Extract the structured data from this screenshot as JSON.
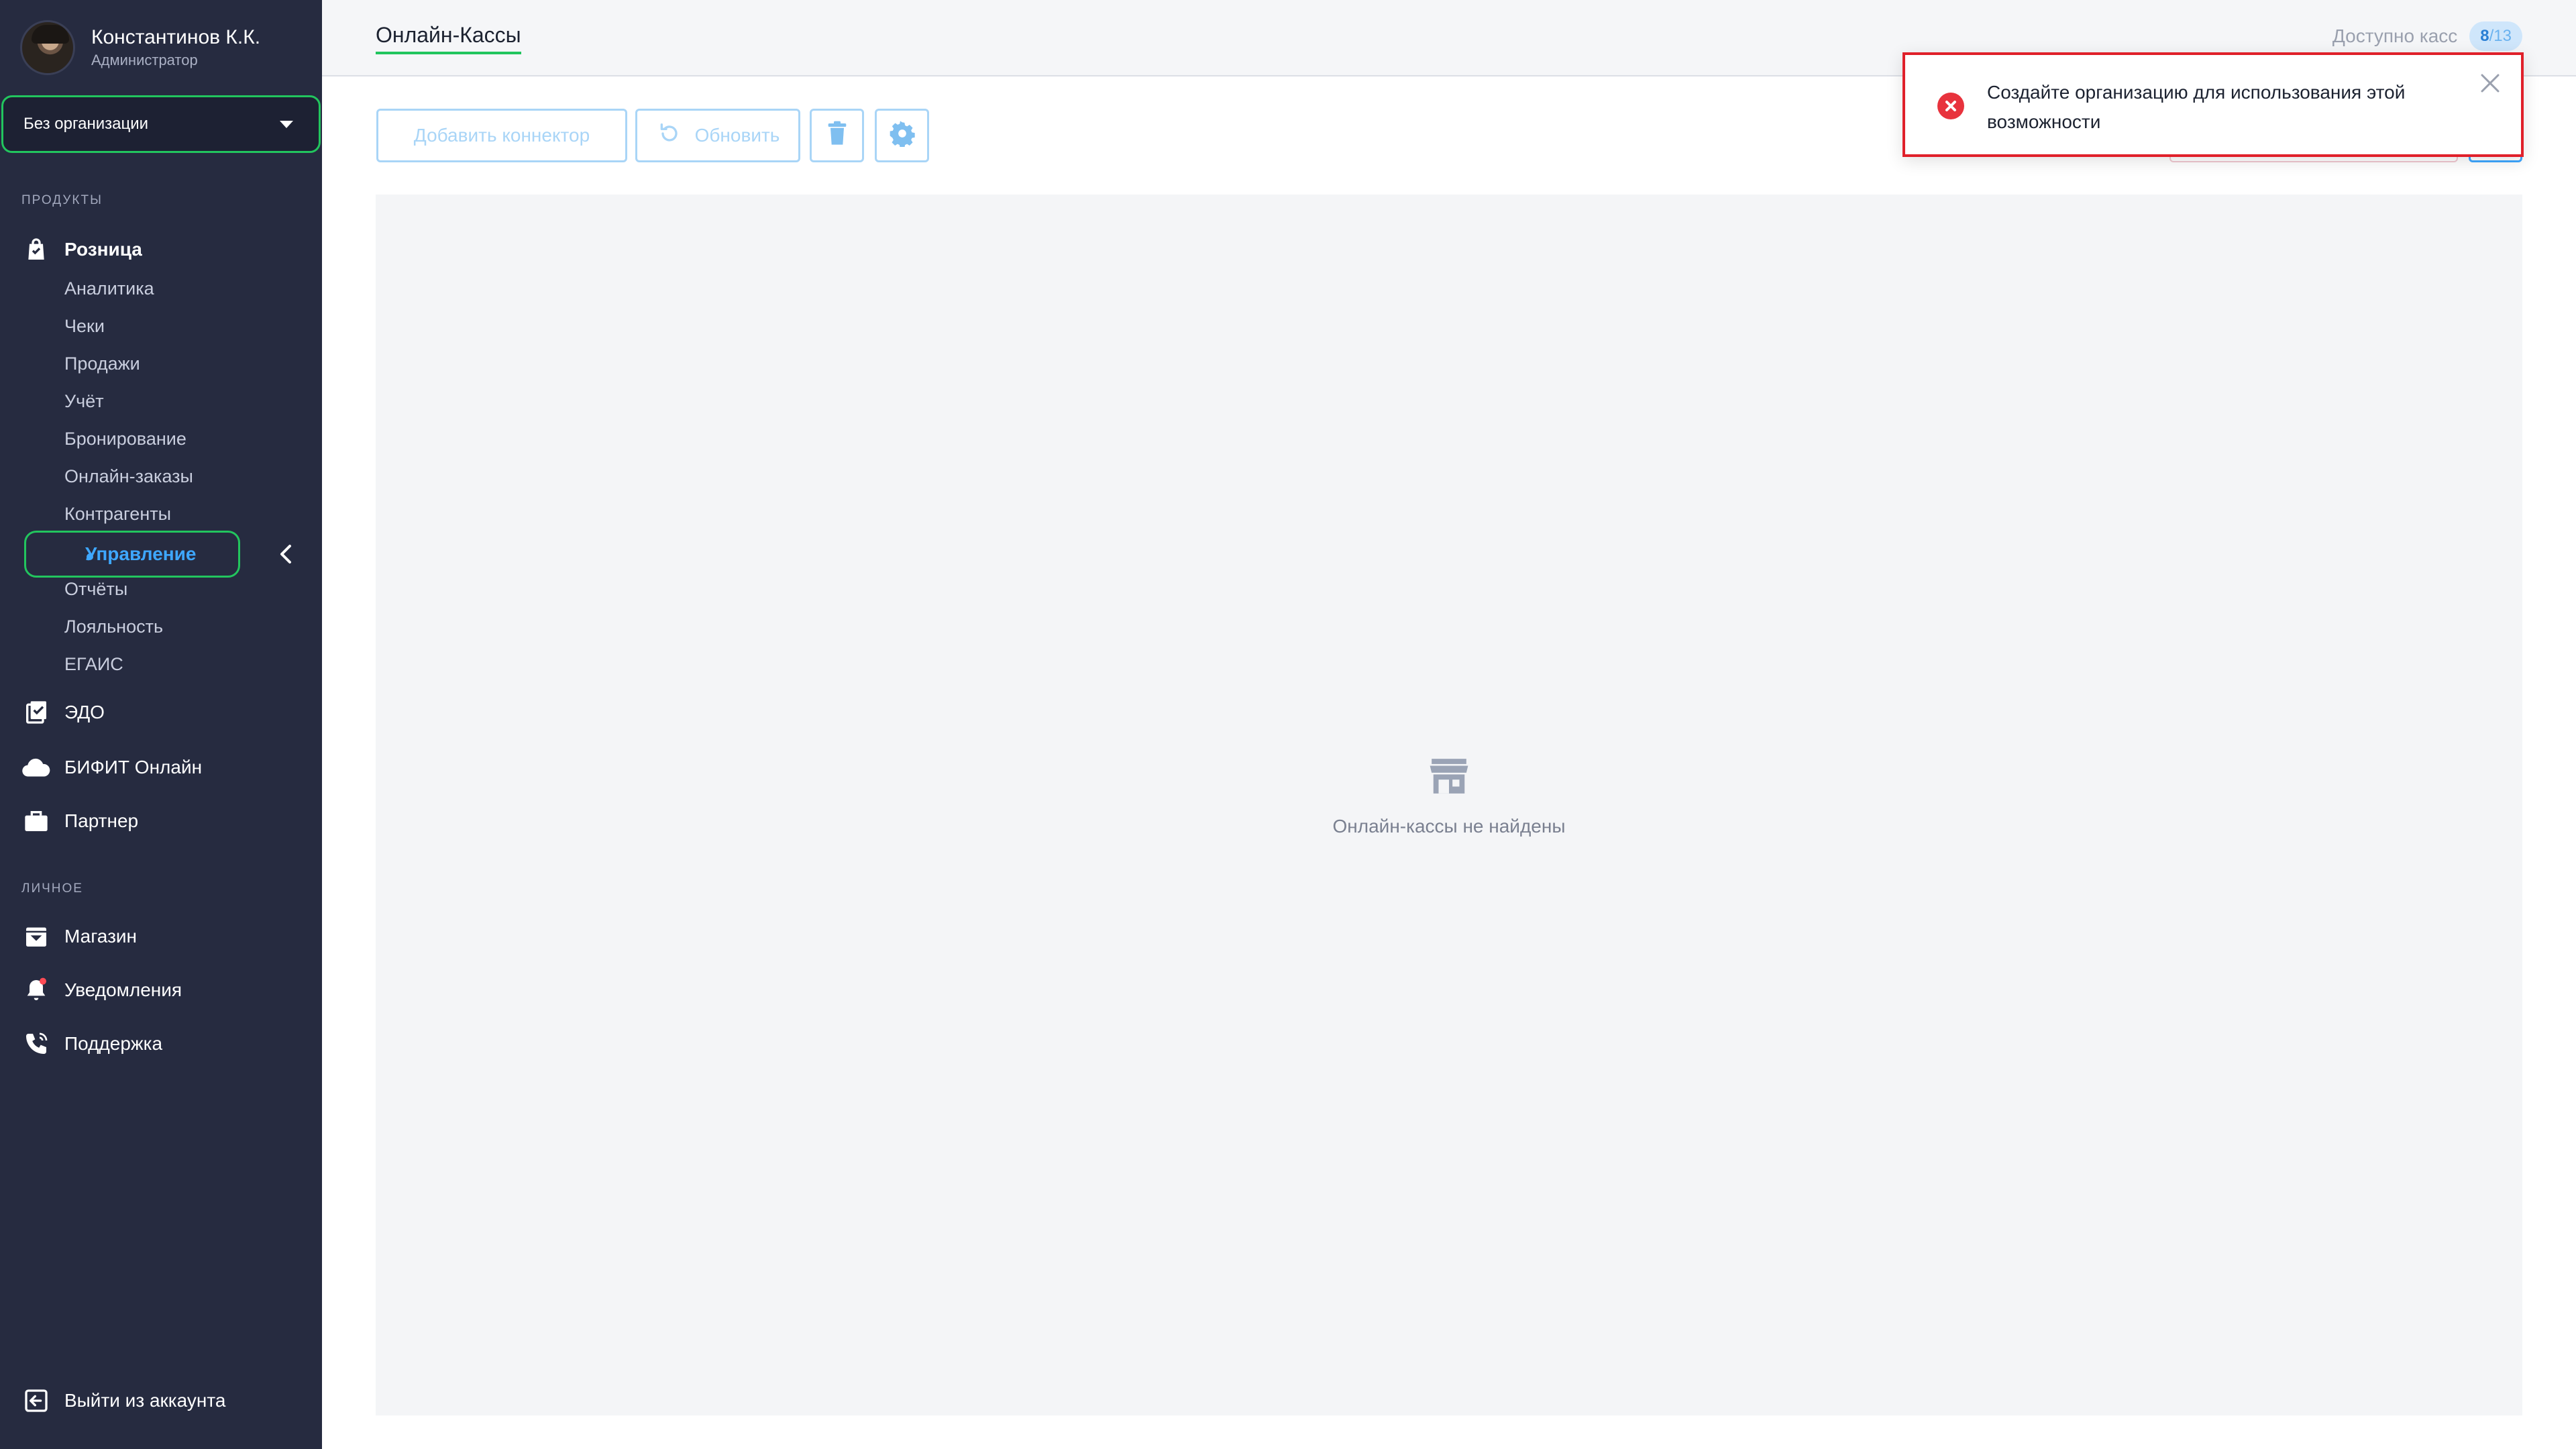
{
  "user": {
    "name": "Константинов К.К.",
    "role": "Администратор"
  },
  "org_select": {
    "value": "Без организации"
  },
  "sidebar": {
    "section_products": "ПРОДУКТЫ",
    "retail": {
      "label": "Розница",
      "icon": "shopping-bag-icon",
      "subitems": [
        "Аналитика",
        "Чеки",
        "Продажи",
        "Учёт",
        "Бронирование",
        "Онлайн-заказы",
        "Контрагенты",
        "Управление",
        "Отчёты",
        "Лояльность",
        "ЕГАИС"
      ],
      "active_subitem": "Управление"
    },
    "products": [
      {
        "label": "ЭДО",
        "icon": "clipboard-check-icon"
      },
      {
        "label": "БИФИТ Онлайн",
        "icon": "cloud-icon"
      },
      {
        "label": "Партнер",
        "icon": "briefcase-icon"
      }
    ],
    "section_personal": "ЛИЧНОЕ",
    "personal": [
      {
        "label": "Магазин",
        "icon": "store-box-icon"
      },
      {
        "label": "Уведомления",
        "icon": "bell-icon"
      },
      {
        "label": "Поддержка",
        "icon": "phone-icon"
      }
    ],
    "logout": {
      "label": "Выйти из аккаунта",
      "icon": "logout-icon"
    }
  },
  "header": {
    "title": "Онлайн-Кассы",
    "available_label": "Доступно касс",
    "available_used": "8",
    "available_total": "/13"
  },
  "toolbar": {
    "add_label": "Добавить коннектор",
    "refresh_label": "Обновить"
  },
  "content": {
    "empty_text": "Онлайн-кассы не найдены"
  },
  "toast": {
    "message": "Создайте организацию для использования этой возможности"
  },
  "colors": {
    "sidebar_bg": "#262b40",
    "accent_blue": "#3ea7ff",
    "highlight_green": "#22c55e",
    "error_red": "#e0202a"
  }
}
